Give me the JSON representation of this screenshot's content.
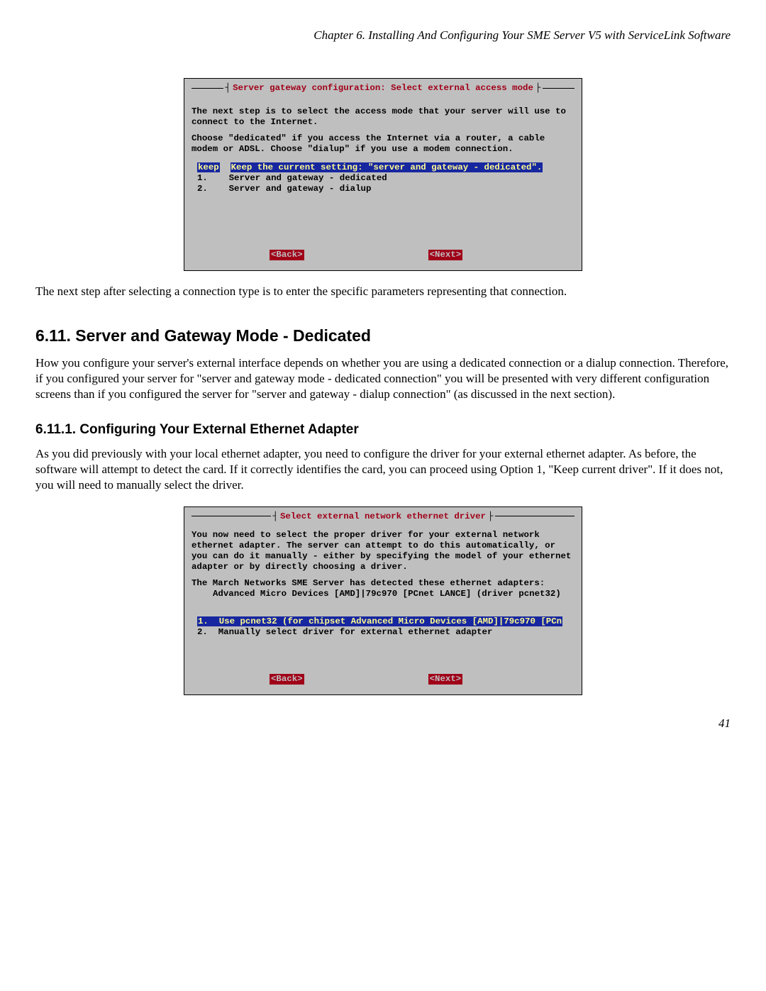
{
  "header": "Chapter 6. Installing And Configuring Your SME Server V5 with ServiceLink Software",
  "screenshot1": {
    "title": "Server gateway configuration: Select external access mode",
    "para1": "The next step is to select the access mode that your server will use to connect to the Internet.",
    "para2": "Choose \"dedicated\" if you access the Internet via a router, a cable modem or ADSL. Choose \"dialup\" if you use a modem connection.",
    "opt_sel_key": "keep",
    "opt_sel_label": "Keep the current setting: \"server and gateway - dedicated\".",
    "opt1_key": "1.",
    "opt1_label": "Server and gateway - dedicated",
    "opt2_key": "2.",
    "opt2_label": "Server and gateway - dialup",
    "back": "<Back>",
    "next": "<Next>",
    "block_open": "┤",
    "block_close": "├"
  },
  "caption1": "The next step after selecting a connection type is to enter the specific parameters representing that connection.",
  "section_heading": "6.11. Server and Gateway Mode - Dedicated",
  "section_para": "How you configure your server's external interface depends on whether you are using a dedicated connection or a dialup connection. Therefore, if you configured your server for \"server and gateway mode - dedicated connection\" you will be presented with very different configuration screens than if you configured the server for \"server and gateway - dialup connection\" (as discussed in the next section).",
  "subsection_heading": "6.11.1. Configuring Your External Ethernet Adapter",
  "subsection_para": "As you did previously with your local ethernet adapter, you need to configure the driver for your external ethernet adapter. As before, the software will attempt to detect the card. If it correctly identifies the card, you can proceed using Option 1, \"Keep current driver\". If it does not, you will need to manually select the driver.",
  "screenshot2": {
    "title": "Select external network ethernet driver",
    "para1": "You now need to select the proper driver for your external network ethernet adapter. The server can attempt to do this automatically, or you can do it manually - either by specifying the model of your ethernet adapter or by directly choosing a driver.",
    "para2": "The March Networks SME Server has detected these ethernet adapters:",
    "detected": "Advanced Micro Devices [AMD]|79c970 [PCnet LANCE] (driver pcnet32)",
    "opt_sel_key": "1.",
    "opt_sel_label": "Use pcnet32 (for chipset Advanced Micro Devices [AMD]|79c970 [PCn",
    "opt2_key": "2.",
    "opt2_label": "Manually select driver for external ethernet adapter",
    "back": "<Back>",
    "next": "<Next>",
    "block_open": "┤",
    "block_close": "├"
  },
  "page_number": "41"
}
